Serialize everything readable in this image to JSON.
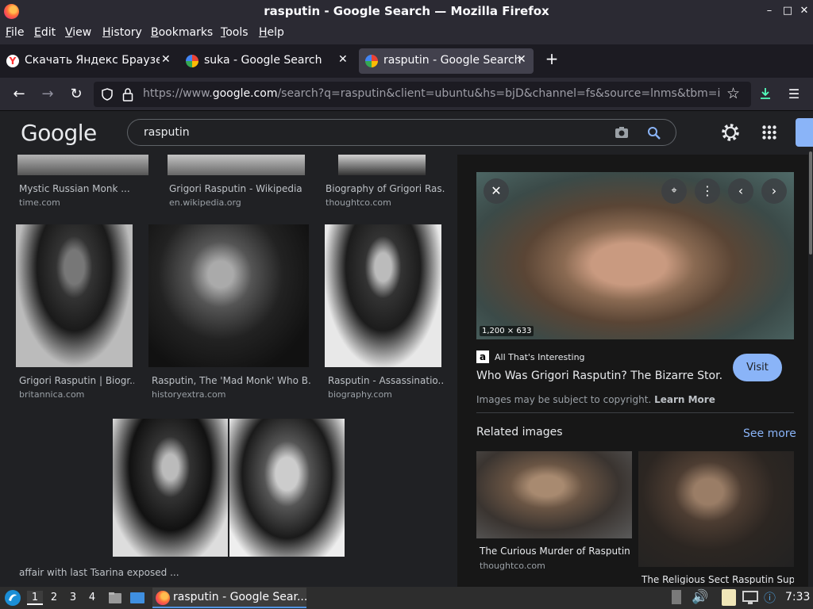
{
  "window": {
    "title": "rasputin - Google Search — Mozilla Firefox"
  },
  "menu": [
    "File",
    "Edit",
    "View",
    "History",
    "Bookmarks",
    "Tools",
    "Help"
  ],
  "tabs": [
    {
      "label": "Скачать Яндекс Браузер"
    },
    {
      "label": "suka - Google Search"
    },
    {
      "label": "rasputin - Google Search"
    }
  ],
  "address": {
    "scheme": "https://www.",
    "domain": "google.com",
    "path": "/search?q=rasputin&client=ubuntu&hs=bjD&channel=fs&source=lnms&tbm=i"
  },
  "google": {
    "logo": "Google",
    "query": "rasputin"
  },
  "results": [
    {
      "title": "Mystic Russian Monk ...",
      "source": "time.com"
    },
    {
      "title": "Grigori Rasputin - Wikipedia",
      "source": "en.wikipedia.org"
    },
    {
      "title": "Biography of Grigori Ras...",
      "source": "thoughtco.com"
    },
    {
      "title": "Grigori Rasputin | Biogr...",
      "source": "britannica.com"
    },
    {
      "title": "Rasputin, The 'Mad Monk' Who B...",
      "source": "historyextra.com"
    },
    {
      "title": "Rasputin - Assassinatio...",
      "source": "biography.com"
    },
    {
      "title": "affair with last Tsarina exposed ...",
      "source": ""
    }
  ],
  "preview": {
    "dimensions": "1,200 × 633",
    "site": "All That's Interesting",
    "title": "Who Was Grigori Rasputin? The Bizarre Stor...",
    "visit": "Visit",
    "copyright": "Images may be subject to copyright.",
    "learn_more": "Learn More",
    "related_heading": "Related images",
    "see_more": "See more",
    "related": [
      {
        "title": "The Curious Murder of Rasputin",
        "source": "thoughtco.com"
      },
      {
        "title": "The Religious Sect Rasputin Sup..."
      }
    ]
  },
  "taskbar": {
    "workspaces": [
      "1",
      "2",
      "3",
      "4"
    ],
    "window_button": "rasputin - Google Sear...",
    "clock": "7:33"
  }
}
